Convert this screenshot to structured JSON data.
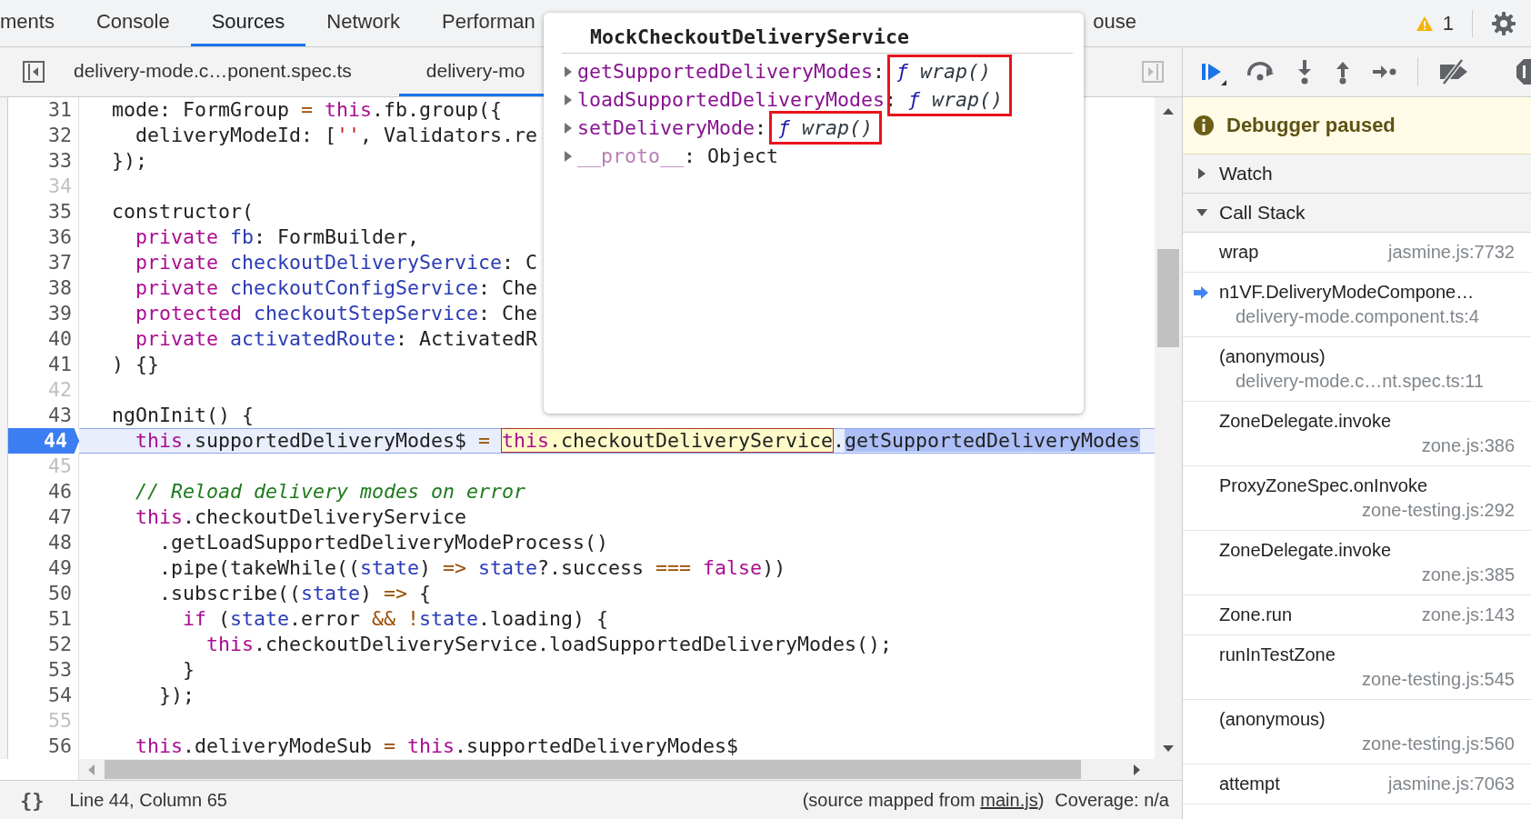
{
  "main_tabs": [
    {
      "label": "ments",
      "selected": false
    },
    {
      "label": "Console",
      "selected": false
    },
    {
      "label": "Sources",
      "selected": true
    },
    {
      "label": "Network",
      "selected": false
    },
    {
      "label": "Performan",
      "selected": false
    },
    {
      "label": "ouse",
      "selected": false
    }
  ],
  "issues": {
    "count": "1"
  },
  "file_tabs": [
    {
      "label": "delivery-mode.c…ponent.spec.ts",
      "selected": false
    },
    {
      "label": "delivery-mo",
      "selected": true
    }
  ],
  "code_lines": [
    {
      "number": "31",
      "breakable": true,
      "current": false,
      "segments": [
        {
          "text": "mode: FormGroup ",
          "kind": "plain"
        },
        {
          "text": "= ",
          "kind": "operator"
        },
        {
          "text": "this",
          "kind": "keyword"
        },
        {
          "text": ".fb.group({",
          "kind": "plain"
        }
      ]
    },
    {
      "number": "32",
      "breakable": true,
      "current": false,
      "segments": [
        {
          "text": "  deliveryModeId: [",
          "kind": "plain"
        },
        {
          "text": "''",
          "kind": "string"
        },
        {
          "text": ", Validators.re",
          "kind": "plain"
        }
      ]
    },
    {
      "number": "33",
      "breakable": true,
      "current": false,
      "segments": [
        {
          "text": "});",
          "kind": "plain"
        }
      ]
    },
    {
      "number": "34",
      "breakable": false,
      "current": false
    },
    {
      "number": "35",
      "breakable": true,
      "current": false,
      "segments": [
        {
          "text": "constructor(",
          "kind": "plain"
        }
      ]
    },
    {
      "number": "36",
      "breakable": true,
      "current": false,
      "segments": [
        {
          "text": "  private ",
          "kind": "keyword"
        },
        {
          "text": "fb",
          "kind": "variable"
        },
        {
          "text": ": FormBuilder,",
          "kind": "plain"
        }
      ]
    },
    {
      "number": "37",
      "breakable": true,
      "current": false,
      "segments": [
        {
          "text": "  private ",
          "kind": "keyword"
        },
        {
          "text": "checkoutDeliveryService",
          "kind": "variable"
        },
        {
          "text": ": C",
          "kind": "plain"
        }
      ]
    },
    {
      "number": "38",
      "breakable": true,
      "current": false,
      "segments": [
        {
          "text": "  private ",
          "kind": "keyword"
        },
        {
          "text": "checkoutConfigService",
          "kind": "variable"
        },
        {
          "text": ": Che",
          "kind": "plain"
        }
      ]
    },
    {
      "number": "39",
      "breakable": true,
      "current": false,
      "segments": [
        {
          "text": "  protected ",
          "kind": "keyword"
        },
        {
          "text": "checkoutStepService",
          "kind": "variable"
        },
        {
          "text": ": Che",
          "kind": "plain"
        }
      ]
    },
    {
      "number": "40",
      "breakable": true,
      "current": false,
      "segments": [
        {
          "text": "  private ",
          "kind": "keyword"
        },
        {
          "text": "activatedRoute",
          "kind": "variable"
        },
        {
          "text": ": ActivatedR",
          "kind": "plain"
        }
      ]
    },
    {
      "number": "41",
      "breakable": true,
      "current": false,
      "segments": [
        {
          "text": ") {}",
          "kind": "plain"
        }
      ]
    },
    {
      "number": "42",
      "breakable": false,
      "current": false
    },
    {
      "number": "43",
      "breakable": true,
      "current": false,
      "segments": [
        {
          "text": "ngOnInit() {",
          "kind": "plain"
        }
      ]
    },
    {
      "number": "44",
      "breakable": true,
      "current": true,
      "segments": [
        {
          "text": "  this",
          "kind": "keyword",
          "hovered": false,
          "selected": false
        },
        {
          "text": ".supportedDeliveryModes$ ",
          "kind": "plain",
          "hovered": false,
          "selected": false
        },
        {
          "text": "= ",
          "kind": "operator",
          "hovered": false,
          "selected": false
        },
        {
          "text": "this",
          "kind": "keyword",
          "hovered": true,
          "selected": false
        },
        {
          "text": ".checkoutDeliveryService",
          "kind": "plain",
          "hovered": true,
          "selected": false
        },
        {
          "text": ".",
          "kind": "plain",
          "hovered": false,
          "selected": false
        },
        {
          "text": "getSupportedDeliveryModes",
          "kind": "plain",
          "hovered": false,
          "selected": true
        }
      ]
    },
    {
      "number": "45",
      "breakable": false,
      "current": false
    },
    {
      "number": "46",
      "breakable": true,
      "current": false,
      "segments": [
        {
          "text": "  // Reload delivery modes on error",
          "kind": "comment"
        }
      ]
    },
    {
      "number": "47",
      "breakable": true,
      "current": false,
      "segments": [
        {
          "text": "  this",
          "kind": "keyword"
        },
        {
          "text": ".checkoutDeliveryService",
          "kind": "plain"
        }
      ]
    },
    {
      "number": "48",
      "breakable": true,
      "current": false,
      "segments": [
        {
          "text": "    .getLoadSupportedDeliveryModeProcess()",
          "kind": "plain"
        }
      ]
    },
    {
      "number": "49",
      "breakable": true,
      "current": false,
      "segments": [
        {
          "text": "    .pipe(takeWhile((",
          "kind": "plain"
        },
        {
          "text": "state",
          "kind": "variable"
        },
        {
          "text": ") ",
          "kind": "plain"
        },
        {
          "text": "=> ",
          "kind": "operator"
        },
        {
          "text": "state",
          "kind": "variable"
        },
        {
          "text": "?.success ",
          "kind": "plain"
        },
        {
          "text": "=== ",
          "kind": "operator"
        },
        {
          "text": "false",
          "kind": "keyword"
        },
        {
          "text": "))",
          "kind": "plain"
        }
      ]
    },
    {
      "number": "50",
      "breakable": true,
      "current": false,
      "segments": [
        {
          "text": "    .subscribe((",
          "kind": "plain"
        },
        {
          "text": "state",
          "kind": "variable"
        },
        {
          "text": ") ",
          "kind": "plain"
        },
        {
          "text": "=>",
          "kind": "operator"
        },
        {
          "text": " {",
          "kind": "plain"
        }
      ]
    },
    {
      "number": "51",
      "breakable": true,
      "current": false,
      "segments": [
        {
          "text": "      if",
          "kind": "keyword"
        },
        {
          "text": " (",
          "kind": "plain"
        },
        {
          "text": "state",
          "kind": "variable"
        },
        {
          "text": ".error ",
          "kind": "plain"
        },
        {
          "text": "&& !",
          "kind": "operator"
        },
        {
          "text": "state",
          "kind": "variable"
        },
        {
          "text": ".loading) {",
          "kind": "plain"
        }
      ]
    },
    {
      "number": "52",
      "breakable": true,
      "current": false,
      "segments": [
        {
          "text": "        this",
          "kind": "keyword"
        },
        {
          "text": ".checkoutDeliveryService.loadSupportedDeliveryModes();",
          "kind": "plain"
        }
      ]
    },
    {
      "number": "53",
      "breakable": true,
      "current": false,
      "segments": [
        {
          "text": "      }",
          "kind": "plain"
        }
      ]
    },
    {
      "number": "54",
      "breakable": true,
      "current": false,
      "segments": [
        {
          "text": "    });",
          "kind": "plain"
        }
      ]
    },
    {
      "number": "55",
      "breakable": false,
      "current": false
    },
    {
      "number": "56",
      "breakable": true,
      "current": false,
      "segments": [
        {
          "text": "  this",
          "kind": "keyword"
        },
        {
          "text": ".deliveryModeSub ",
          "kind": "plain"
        },
        {
          "text": "= ",
          "kind": "operator"
        },
        {
          "text": "this",
          "kind": "keyword"
        },
        {
          "text": ".supportedDeliveryModes$",
          "kind": "plain"
        }
      ]
    }
  ],
  "popover": {
    "title": "MockCheckoutDeliveryService",
    "properties": [
      {
        "name": "getSupportedDeliveryModes",
        "kind": "method",
        "separator": ":",
        "type_mark": "ƒ",
        "value": "wrap()",
        "expanded": false,
        "outlined": true,
        "outline_joins_next": true
      },
      {
        "name": "loadSupportedDeliveryModes",
        "kind": "method",
        "separator": ":",
        "type_mark": "ƒ",
        "value": "wrap()",
        "expanded": false,
        "outlined": true
      },
      {
        "name": "setDeliveryMode",
        "kind": "method",
        "separator": ":",
        "type_mark": "ƒ",
        "value": "wrap()",
        "expanded": false,
        "outlined": true
      },
      {
        "name": "__proto__",
        "kind": "internal",
        "separator": ":",
        "value": "Object",
        "expanded": false,
        "outlined": false
      }
    ]
  },
  "debugger": {
    "banner": "Debugger paused",
    "sections": [
      {
        "title": "Watch",
        "expanded": false
      },
      {
        "title": "Call Stack",
        "expanded": true
      }
    ],
    "call_stack": [
      {
        "name": "wrap",
        "location": "jasmine.js:7732",
        "kind": "inline",
        "selected": false
      },
      {
        "name": "n1VF.DeliveryModeCompone…",
        "location": "delivery-mode.component.ts:4",
        "kind": "indented",
        "selected": true
      },
      {
        "name": "(anonymous)",
        "location": "delivery-mode.c…nt.spec.ts:11",
        "kind": "indented",
        "selected": false
      },
      {
        "name": "ZoneDelegate.invoke",
        "location": "zone.js:386",
        "kind": "below",
        "selected": false
      },
      {
        "name": "ProxyZoneSpec.onInvoke",
        "location": "zone-testing.js:292",
        "kind": "below",
        "selected": false
      },
      {
        "name": "ZoneDelegate.invoke",
        "location": "zone.js:385",
        "kind": "below",
        "selected": false
      },
      {
        "name": "Zone.run",
        "location": "zone.js:143",
        "kind": "inline",
        "selected": false
      },
      {
        "name": "runInTestZone",
        "location": "zone-testing.js:545",
        "kind": "below",
        "selected": false
      },
      {
        "name": "(anonymous)",
        "location": "zone-testing.js:560",
        "kind": "below",
        "selected": false
      },
      {
        "name": "attempt",
        "location": "jasmine.js:7063",
        "kind": "inline",
        "selected": false
      }
    ]
  },
  "status_bar": {
    "format_button": "{}",
    "position": "Line 44, Column 65",
    "source_prefix": "(source mapped from ",
    "source_link": "main.js",
    "source_suffix": ")",
    "coverage": "Coverage: n/a"
  }
}
